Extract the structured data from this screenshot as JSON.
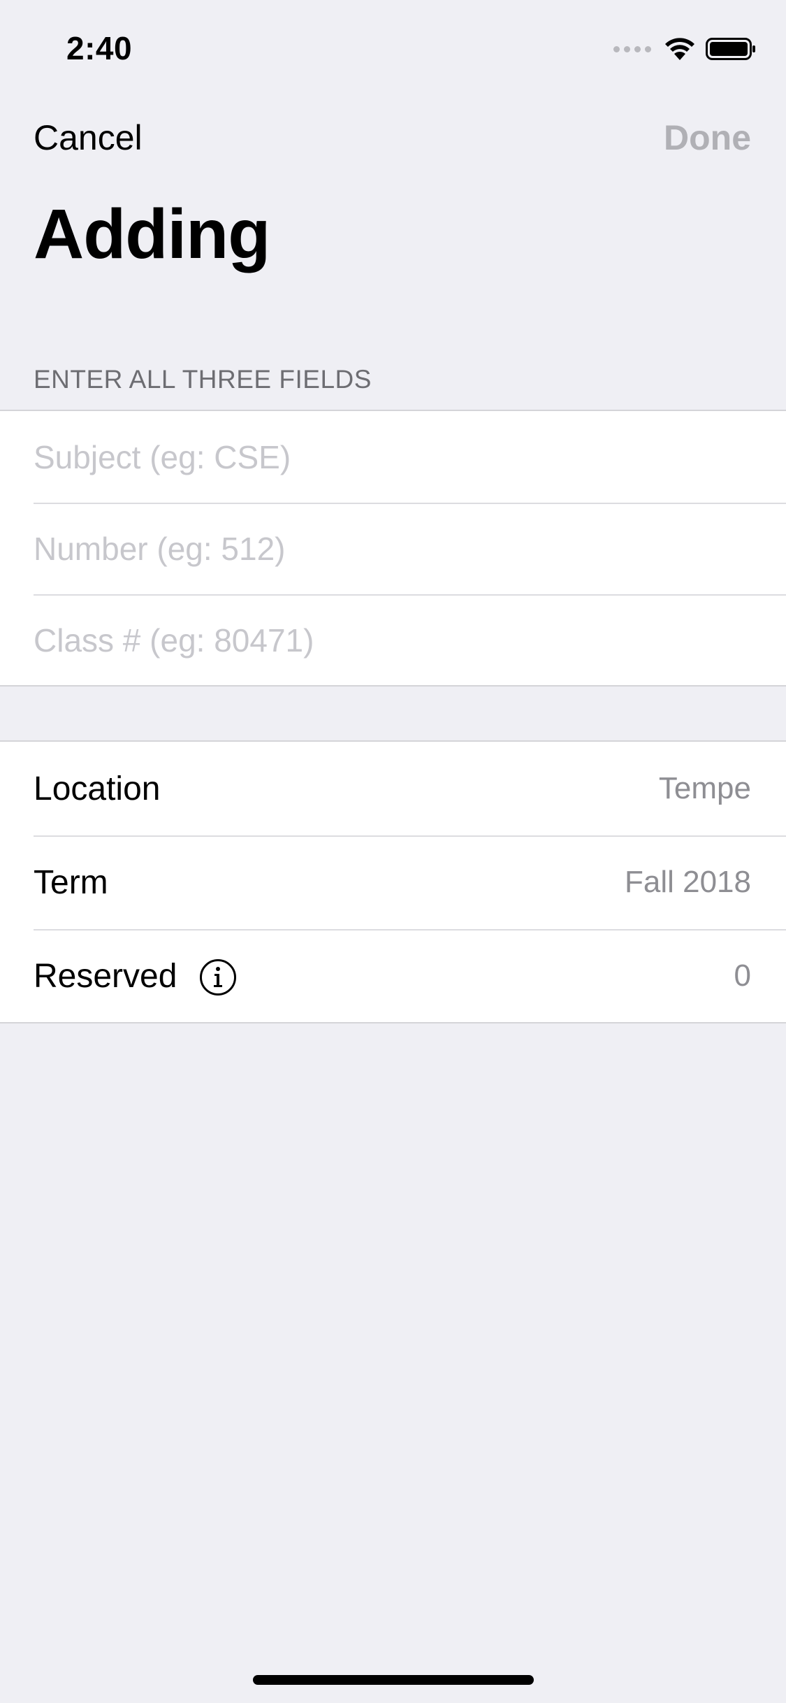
{
  "status_bar": {
    "time": "2:40"
  },
  "nav": {
    "cancel_label": "Cancel",
    "done_label": "Done",
    "title": "Adding"
  },
  "form": {
    "section_header": "ENTER ALL THREE FIELDS",
    "fields": [
      {
        "placeholder": "Subject (eg: CSE)",
        "value": ""
      },
      {
        "placeholder": "Number (eg: 512)",
        "value": ""
      },
      {
        "placeholder": "Class # (eg: 80471)",
        "value": ""
      }
    ]
  },
  "details": {
    "rows": [
      {
        "label": "Location",
        "value": "Tempe"
      },
      {
        "label": "Term",
        "value": "Fall 2018"
      },
      {
        "label": "Reserved",
        "value": "0",
        "icon": "info-icon"
      }
    ]
  },
  "colors": {
    "background": "#efeff4",
    "disabled": "#b0b0b5",
    "secondary_text": "#8e8e93",
    "placeholder": "#c7c7cc"
  }
}
